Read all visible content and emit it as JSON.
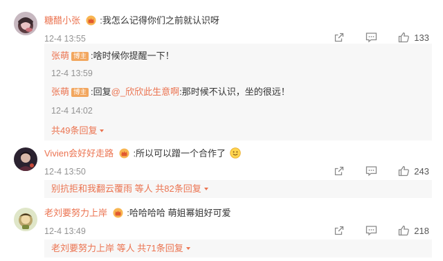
{
  "comments": [
    {
      "username": "糖醋小张",
      "text": ":我怎么记得你们之前就认识呀",
      "time": "12-4 13:55",
      "likes": "133",
      "replies": [
        {
          "username": "张萌",
          "owner_tag": "博主",
          "text": ":啥时候你提醒一下！",
          "time": "12-4 13:59"
        },
        {
          "username": "张萌",
          "owner_tag": "博主",
          "prefix": ":回复",
          "mention": "@_欣欣此生意啊",
          "text": ":那时候不认识，坐的很远！",
          "time": "12-4 14:02"
        }
      ],
      "more_replies": "共49条回复"
    },
    {
      "username": "Vivien会好好走路",
      "text": ":所以可以蹭一个合作了",
      "time": "12-4 13:50",
      "likes": "243",
      "summary_users": "别抗拒和我翻云覆雨",
      "summary_rest": " 等人 共82条回复"
    },
    {
      "username": "老刘要努力上岸",
      "text": ":哈哈哈哈 萌姐幂姐好可爱",
      "time": "12-4 13:49",
      "likes": "218",
      "summary_users": "老刘要努力上岸",
      "summary_rest": " 等人 共71条回复"
    }
  ],
  "icons": {
    "share": "share-icon",
    "comment": "comment-icon",
    "like": "thumbs-up-icon",
    "crown": "crown-badge-icon"
  },
  "colors": {
    "username": "#eb7350",
    "time": "#939393",
    "reply_bg": "#f7f7f7",
    "owner_tag": "#f2a65e"
  }
}
